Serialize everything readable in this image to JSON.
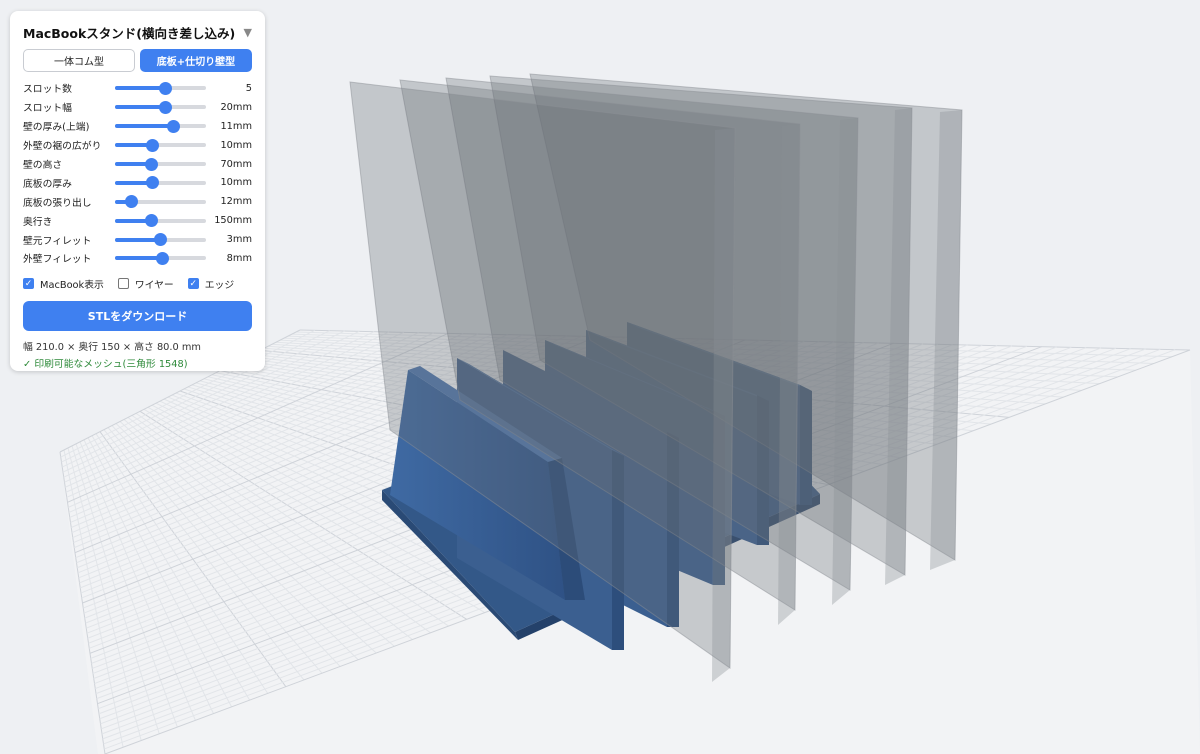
{
  "panel": {
    "title": "MacBookスタンド(横向き差し込み)",
    "collapse_icon": "▼",
    "modes": [
      {
        "label": "一体コム型",
        "active": false
      },
      {
        "label": "底板+仕切り壁型",
        "active": true
      }
    ],
    "sliders": [
      {
        "label": "スロット数",
        "value": "5",
        "level": 0.56
      },
      {
        "label": "スロット幅",
        "value": "20mm",
        "level": 0.56
      },
      {
        "label": "壁の厚み(上端)",
        "value": "11mm",
        "level": 0.64
      },
      {
        "label": "外壁の裾の広がり",
        "value": "10mm",
        "level": 0.41
      },
      {
        "label": "壁の高さ",
        "value": "70mm",
        "level": 0.4
      },
      {
        "label": "底板の厚み",
        "value": "10mm",
        "level": 0.41
      },
      {
        "label": "底板の張り出し",
        "value": "12mm",
        "level": 0.18
      },
      {
        "label": "奥行き",
        "value": "150mm",
        "level": 0.4
      },
      {
        "label": "壁元フィレット",
        "value": "3mm",
        "level": 0.5
      },
      {
        "label": "外壁フィレット",
        "value": "8mm",
        "level": 0.52
      }
    ],
    "checkboxes": [
      {
        "label": "MacBook表示",
        "checked": true
      },
      {
        "label": "ワイヤー",
        "checked": false
      },
      {
        "label": "エッジ",
        "checked": true
      }
    ],
    "download_label": "STLをダウンロード",
    "dimensions": "幅 210.0 × 奥行 150 × 高さ 80.0 mm",
    "mesh_status": "✓ 印刷可能なメッシュ(三角形 1548)"
  },
  "colors": {
    "accent": "#3f80f0",
    "stand": "#3a5f93",
    "ok": "#2e8a3a",
    "background": "#eef0f3"
  },
  "icons": {
    "collapse": "triangle-down-icon",
    "checkbox_on": "check-icon"
  }
}
